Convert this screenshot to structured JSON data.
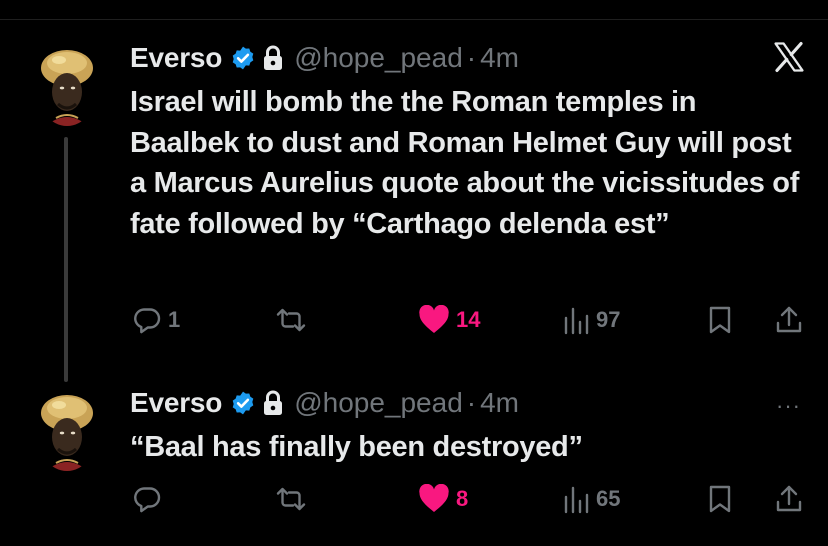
{
  "tweets": [
    {
      "name": "Everso",
      "handle": "@hope_pead",
      "separator": "·",
      "time": "4m",
      "text": "Israel will bomb the the Roman temples in Baalbek to dust and Roman Helmet Guy will post a Marcus Aurelius quote about the vicissitudes of fate followed by “Carthago delenda est”",
      "replies": "1",
      "retweets": "",
      "likes": "14",
      "views": "97"
    },
    {
      "name": "Everso",
      "handle": "@hope_pead",
      "separator": "·",
      "time": "4m",
      "text": "“Baal has finally been destroyed”",
      "replies": "",
      "retweets": "",
      "likes": "8",
      "views": "65"
    }
  ],
  "more_menu": "···",
  "colors": {
    "background": "#000000",
    "text": "#e7e9ea",
    "muted": "#71767b",
    "verified": "#1d9bf0",
    "like": "#f91880"
  },
  "icons": [
    "verified-badge-icon",
    "lock-icon",
    "x-logo-icon",
    "reply-icon",
    "retweet-icon",
    "heart-icon",
    "views-icon",
    "bookmark-icon",
    "share-icon",
    "more-icon"
  ]
}
